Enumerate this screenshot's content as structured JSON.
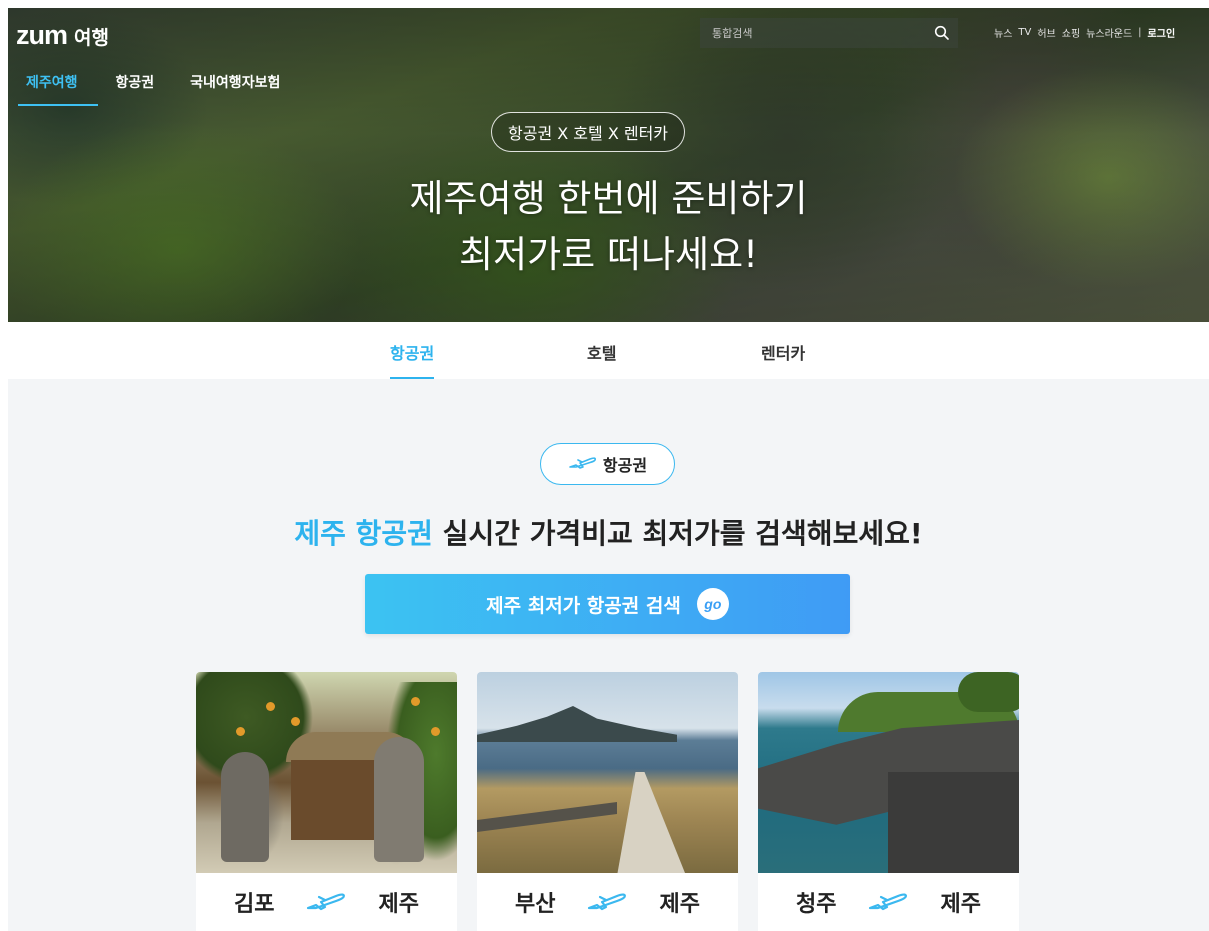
{
  "header": {
    "logo_mark": "zum",
    "logo_sub": "여행",
    "nav": [
      {
        "label": "제주여행",
        "active": true
      },
      {
        "label": "항공권",
        "active": false
      },
      {
        "label": "국내여행자보험",
        "active": false
      }
    ],
    "search": {
      "placeholder": "통합검색",
      "value": ""
    },
    "util_links": [
      "뉴스",
      "TV",
      "허브",
      "쇼핑",
      "뉴스라운드"
    ],
    "login_label": "로그인"
  },
  "hero": {
    "pill": "항공권 X 호텔 X 렌터카",
    "title_line1": "제주여행 한번에 준비하기",
    "title_line2": "최저가로 떠나세요!"
  },
  "tabs": [
    {
      "label": "항공권",
      "active": true
    },
    {
      "label": "호텔",
      "active": false
    },
    {
      "label": "렌터카",
      "active": false
    }
  ],
  "section": {
    "pill_label": "항공권",
    "headline_highlight": "제주 항공권",
    "headline_rest": " 실시간 가격비교 최저가를 검색해보세요!",
    "cta_label": "제주 최저가 항공권 검색",
    "cta_badge": "go"
  },
  "routes": [
    {
      "from": "김포",
      "to": "제주"
    },
    {
      "from": "부산",
      "to": "제주"
    },
    {
      "from": "청주",
      "to": "제주"
    }
  ],
  "colors": {
    "accent": "#2db3ee",
    "cta_start": "#3cc3f2",
    "cta_end": "#3f9bf5",
    "section_bg": "#f3f5f7"
  }
}
